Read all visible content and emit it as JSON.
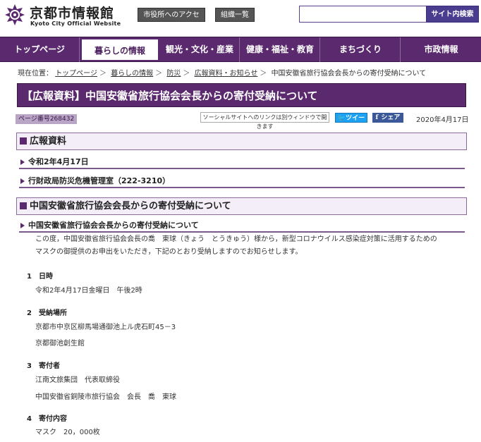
{
  "header": {
    "logo_title": "京都市情報館",
    "logo_sub": "Kyoto City Official Website",
    "access_label": "市役所へのアクセス",
    "org_label": "組織一覧",
    "search_placeholder": "",
    "search_button": "サイト内検索"
  },
  "nav": [
    "トップページ",
    "暮らしの情報",
    "観光・文化・産業",
    "健康・福祉・教育",
    "まちづくり",
    "市政情報"
  ],
  "breadcrumb": {
    "prefix": "現在位置：",
    "items": [
      "トップページ",
      "暮らしの情報",
      "防災",
      "広報資料・お知らせ"
    ],
    "current": "中国安徽省旅行協会会長からの寄付受納について"
  },
  "page": {
    "title": "【広報資料】中国安徽省旅行協会会長からの寄付受納について",
    "page_number": "ページ番号268432",
    "social_note": "ソーシャルサイトへのリンクは別ウィンドウで開きます",
    "tweet": "ツイート",
    "share": "シェア",
    "date": "2020年4月17日"
  },
  "section1": {
    "heading": "広報資料",
    "date": "令和2年4月17日",
    "dept": "行財政局防災危機管理室（222-3210）"
  },
  "section2": {
    "heading": "中国安徽省旅行協会会長からの寄付受納について",
    "subheading": "中国安徽省旅行協会会長からの寄付受納について",
    "intro_1": "この度，中国安徽省旅行協会会長の喬　東球（きょう　とうきゅう）様から，新型コロナウイルス感染症対策に活用するための",
    "intro_2": "マスクの御提供のお申出をいただき，下記のとおり受納しますのでお知らせします。",
    "items": [
      {
        "head": "1　日時",
        "lines": [
          "令和2年4月17日金曜日　午後2時"
        ]
      },
      {
        "head": "2　受納場所",
        "lines": [
          "京都市中京区柳馬場通御池上ル虎石町45－3",
          "京都御池創生館"
        ]
      },
      {
        "head": "3　寄付者",
        "lines": [
          "江南文旅集団　代表取締役",
          "中国安徽省銅陵市旅行協会　会長　喬　東球"
        ]
      },
      {
        "head": "4　寄付内容",
        "lines": [
          "マスク　20，000枚"
        ]
      }
    ]
  }
}
